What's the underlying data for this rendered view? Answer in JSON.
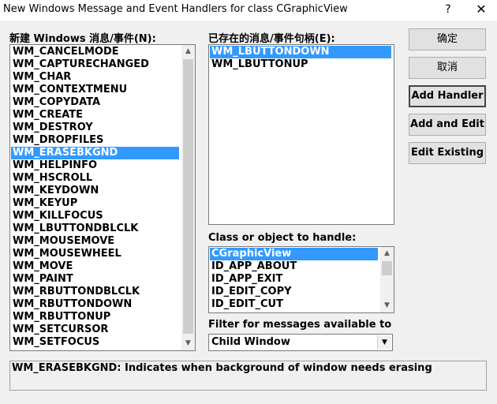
{
  "window": {
    "title": "New Windows Message and Event Handlers for class CGraphicView",
    "help_glyph": "?",
    "close_glyph": "✕"
  },
  "new_messages": {
    "label": "新建 Windows 消息/事件(N):",
    "items": [
      "WM_CANCELMODE",
      "WM_CAPTURECHANGED",
      "WM_CHAR",
      "WM_CONTEXTMENU",
      "WM_COPYDATA",
      "WM_CREATE",
      "WM_DESTROY",
      "WM_DROPFILES",
      "WM_ERASEBKGND",
      "WM_HELPINFO",
      "WM_HSCROLL",
      "WM_KEYDOWN",
      "WM_KEYUP",
      "WM_KILLFOCUS",
      "WM_LBUTTONDBLCLK",
      "WM_MOUSEMOVE",
      "WM_MOUSEWHEEL",
      "WM_MOVE",
      "WM_PAINT",
      "WM_RBUTTONDBLCLK",
      "WM_RBUTTONDOWN",
      "WM_RBUTTONUP",
      "WM_SETCURSOR",
      "WM_SETFOCUS"
    ],
    "selected": "WM_ERASEBKGND"
  },
  "existing_handlers": {
    "label": "已存在的消息/事件句柄(E):",
    "items": [
      "WM_LBUTTONDOWN",
      "WM_LBUTTONUP"
    ],
    "selected": "WM_LBUTTONDOWN"
  },
  "class_object": {
    "label": "Class or object to handle:",
    "items": [
      "CGraphicView",
      "ID_APP_ABOUT",
      "ID_APP_EXIT",
      "ID_EDIT_COPY",
      "ID_EDIT_CUT"
    ],
    "selected": "CGraphicView"
  },
  "filter": {
    "label": "Filter for messages available to",
    "value": "Child Window"
  },
  "buttons": {
    "ok": "确定",
    "cancel": "取消",
    "add_handler": "Add Handler",
    "add_and_edit": "Add and Edit",
    "edit_existing": "Edit Existing"
  },
  "status_text": "WM_ERASEBKGND:  Indicates when background of window needs erasing",
  "icons": {
    "up": "▲",
    "down": "▼"
  },
  "colors": {
    "selection": "#3399ff"
  }
}
